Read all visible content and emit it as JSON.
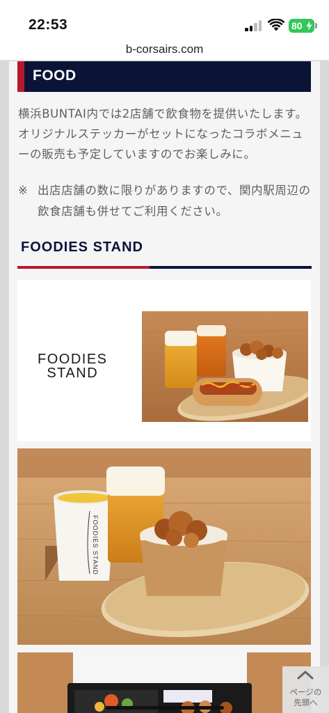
{
  "status_bar": {
    "time": "22:53",
    "battery": "80",
    "icons": [
      "cellular-signal-icon",
      "wifi-icon",
      "battery-charging-icon"
    ]
  },
  "browser": {
    "url": "b-corsairs.com"
  },
  "food_section": {
    "title": "FOOD",
    "description": "横浜BUNTAI内では2店舗で飲食物を提供いたします。オリジナルステッカーがセットになったコラボメニューの販売も予定していますのでお楽しみに。",
    "note_mark": "※",
    "note": "出店店舗の数に限りがありますので、関内駅周辺の飲食店舗も併せてご利用ください。"
  },
  "foodies_stand": {
    "heading": "FOODIES STAND",
    "logo_line1": "FOODIES",
    "logo_line2": "STAND",
    "cup_print": "FOODIES STAND"
  },
  "page_top": {
    "label_line1": "ページの",
    "label_line2": "先頭へ"
  },
  "colors": {
    "navy": "#0b1437",
    "red_accent": "#b8182c",
    "text_gray": "#5e5e5e",
    "battery_green": "#34c759"
  }
}
